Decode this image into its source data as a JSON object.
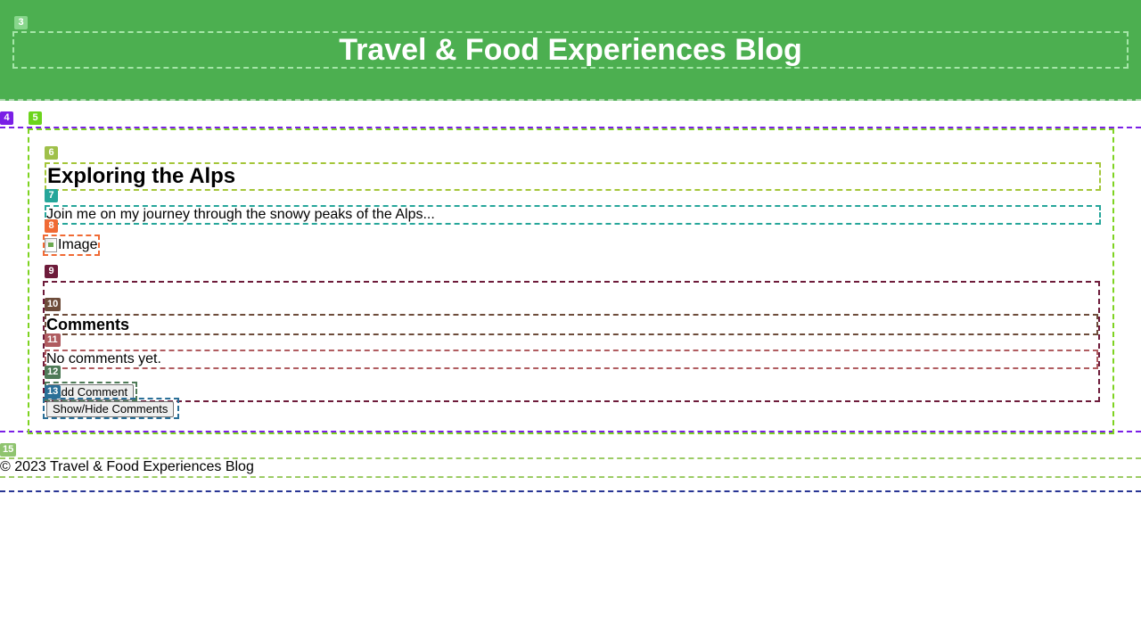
{
  "header": {
    "badge": "3",
    "title": "Travel & Food Experiences Blog",
    "bg_color": "#4caf50"
  },
  "main": {
    "badge": "4",
    "post": {
      "badge": "5",
      "title_badge": "6",
      "title": "Exploring the Alps",
      "excerpt_badge": "7",
      "excerpt": "Join me on my journey through the snowy peaks of the Alps...",
      "image_badge": "8",
      "image_alt": "Image",
      "comments": {
        "badge": "9",
        "heading_badge": "10",
        "heading": "Comments",
        "empty_badge": "11",
        "empty_text": "No comments yet.",
        "add_badge": "12",
        "add_label": "Add Comment"
      },
      "toggle_badge": "13",
      "toggle_label": "Show/Hide Comments"
    }
  },
  "footer": {
    "badge": "15",
    "text": "© 2023 Travel & Food Experiences Blog"
  },
  "badge_colors": {
    "3": "#88d68c",
    "4": "#7a1fe6",
    "5": "#6cd41c",
    "6": "#9fc04a",
    "7": "#26a69a",
    "8": "#f06a34",
    "9": "#6d1b3a",
    "10": "#6d4c3a",
    "11": "#b05c60",
    "12": "#4e7a57",
    "13": "#2a6f97",
    "15": "#8fc46f"
  }
}
